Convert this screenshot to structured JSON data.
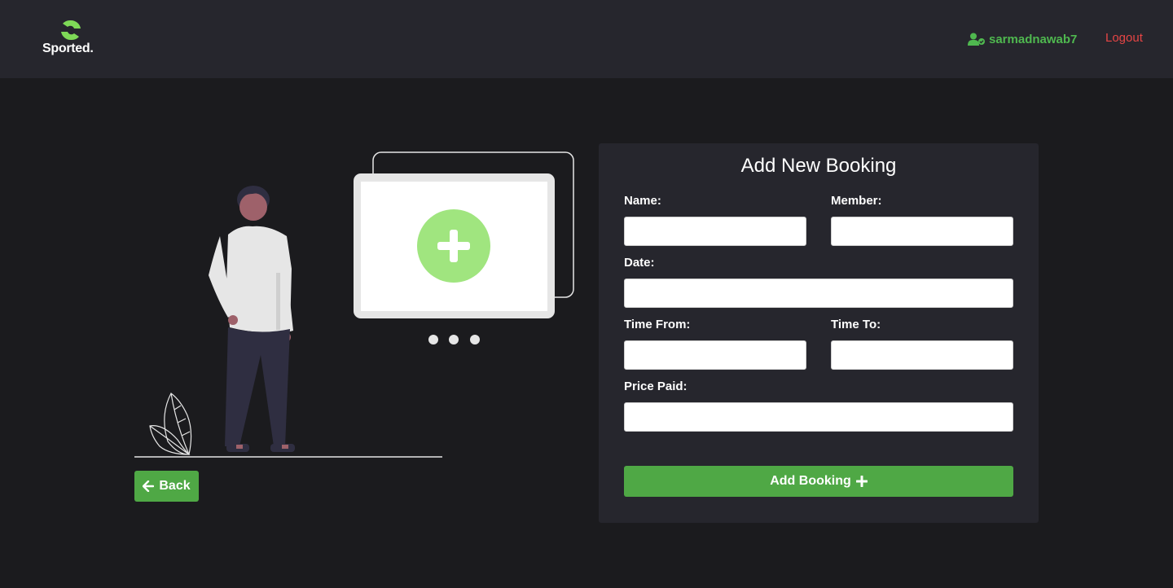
{
  "app": {
    "brand": "Sported."
  },
  "nav": {
    "username": "sarmadnawab7",
    "logout": "Logout"
  },
  "colors": {
    "accent": "#4fa845",
    "user": "#4fb84f",
    "logout": "#e64545",
    "illustration_plus": "#a0e57f"
  },
  "back_button": {
    "label": "Back",
    "icon": "arrow-left-icon"
  },
  "form": {
    "title": "Add New Booking",
    "fields": {
      "name": {
        "label": "Name:",
        "value": "",
        "placeholder": ""
      },
      "member": {
        "label": "Member:",
        "value": "",
        "placeholder": ""
      },
      "date": {
        "label": "Date:",
        "value": "",
        "placeholder": ""
      },
      "time_from": {
        "label": "Time From:",
        "value": "",
        "placeholder": ""
      },
      "time_to": {
        "label": "Time To:",
        "value": "",
        "placeholder": ""
      },
      "price_paid": {
        "label": "Price Paid:",
        "value": "",
        "placeholder": ""
      }
    },
    "submit": {
      "label": "Add Booking",
      "icon": "plus-icon"
    }
  }
}
